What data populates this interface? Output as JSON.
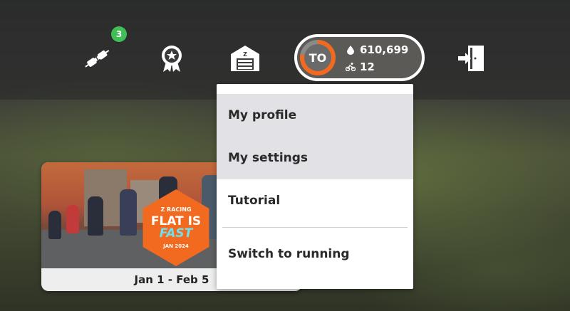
{
  "topbar": {
    "notifications_count": "3",
    "icons": [
      "pairing-icon",
      "achievements-badge-icon",
      "garage-icon",
      "exit-icon"
    ]
  },
  "profile": {
    "initials": "TO",
    "drops": "610,699",
    "level": "12",
    "progress_percent": 78,
    "ring_color": "#f26a1f"
  },
  "event_card": {
    "brand": "Z RACING",
    "title_line1": "FLAT IS",
    "title_line2": "FAST",
    "subtitle": "JAN 2024",
    "date_range": "Jan 1 - Feb 5"
  },
  "menu": {
    "items": [
      {
        "label": "My profile",
        "highlighted": true
      },
      {
        "label": "My settings",
        "highlighted": true
      },
      {
        "label": "Tutorial",
        "highlighted": false
      },
      {
        "label": "Switch to running",
        "highlighted": false
      }
    ]
  },
  "colors": {
    "accent": "#f26a1f",
    "badge": "#3fbf55",
    "menu_highlight": "#e2e2e6"
  }
}
